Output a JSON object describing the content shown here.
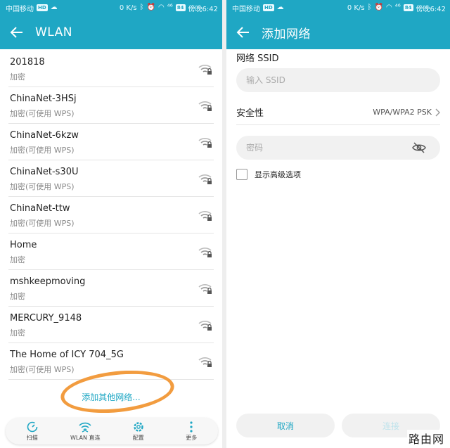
{
  "status_bar": {
    "carrier": "中国移动",
    "speed": "0 K/s",
    "signal_text": "⁴⁶",
    "battery": "84",
    "time": "傍晚6:42"
  },
  "left": {
    "title": "WLAN",
    "networks": [
      {
        "ssid": "201818",
        "security": "加密"
      },
      {
        "ssid": "ChinaNet-3HSj",
        "security": "加密(可使用 WPS)"
      },
      {
        "ssid": "ChinaNet-6kzw",
        "security": "加密(可使用 WPS)"
      },
      {
        "ssid": "ChinaNet-s30U",
        "security": "加密(可使用 WPS)"
      },
      {
        "ssid": "ChinaNet-ttw",
        "security": "加密(可使用 WPS)"
      },
      {
        "ssid": "Home",
        "security": "加密"
      },
      {
        "ssid": "mshkeepmoving",
        "security": "加密"
      },
      {
        "ssid": "MERCURY_9148",
        "security": "加密"
      },
      {
        "ssid": "The Home of ICY 704_5G",
        "security": "加密(可使用 WPS)"
      }
    ],
    "add_network": "添加其他网络...",
    "bottom_nav": [
      {
        "label": "扫描",
        "icon": "refresh-icon"
      },
      {
        "label": "WLAN 直连",
        "icon": "wifi-direct-icon"
      },
      {
        "label": "配置",
        "icon": "gear-icon"
      },
      {
        "label": "更多",
        "icon": "more-vertical-icon"
      }
    ]
  },
  "right": {
    "title": "添加网络",
    "ssid_label": "网络 SSID",
    "ssid_placeholder": "输入 SSID",
    "security_label": "安全性",
    "security_value": "WPA/WPA2 PSK",
    "password_placeholder": "密码",
    "advanced_label": "显示高级选项",
    "cancel": "取消",
    "connect": "连接"
  },
  "watermark": "路由网",
  "colors": {
    "accent": "#1fa7c4",
    "highlight_circle": "#f29c3f"
  }
}
